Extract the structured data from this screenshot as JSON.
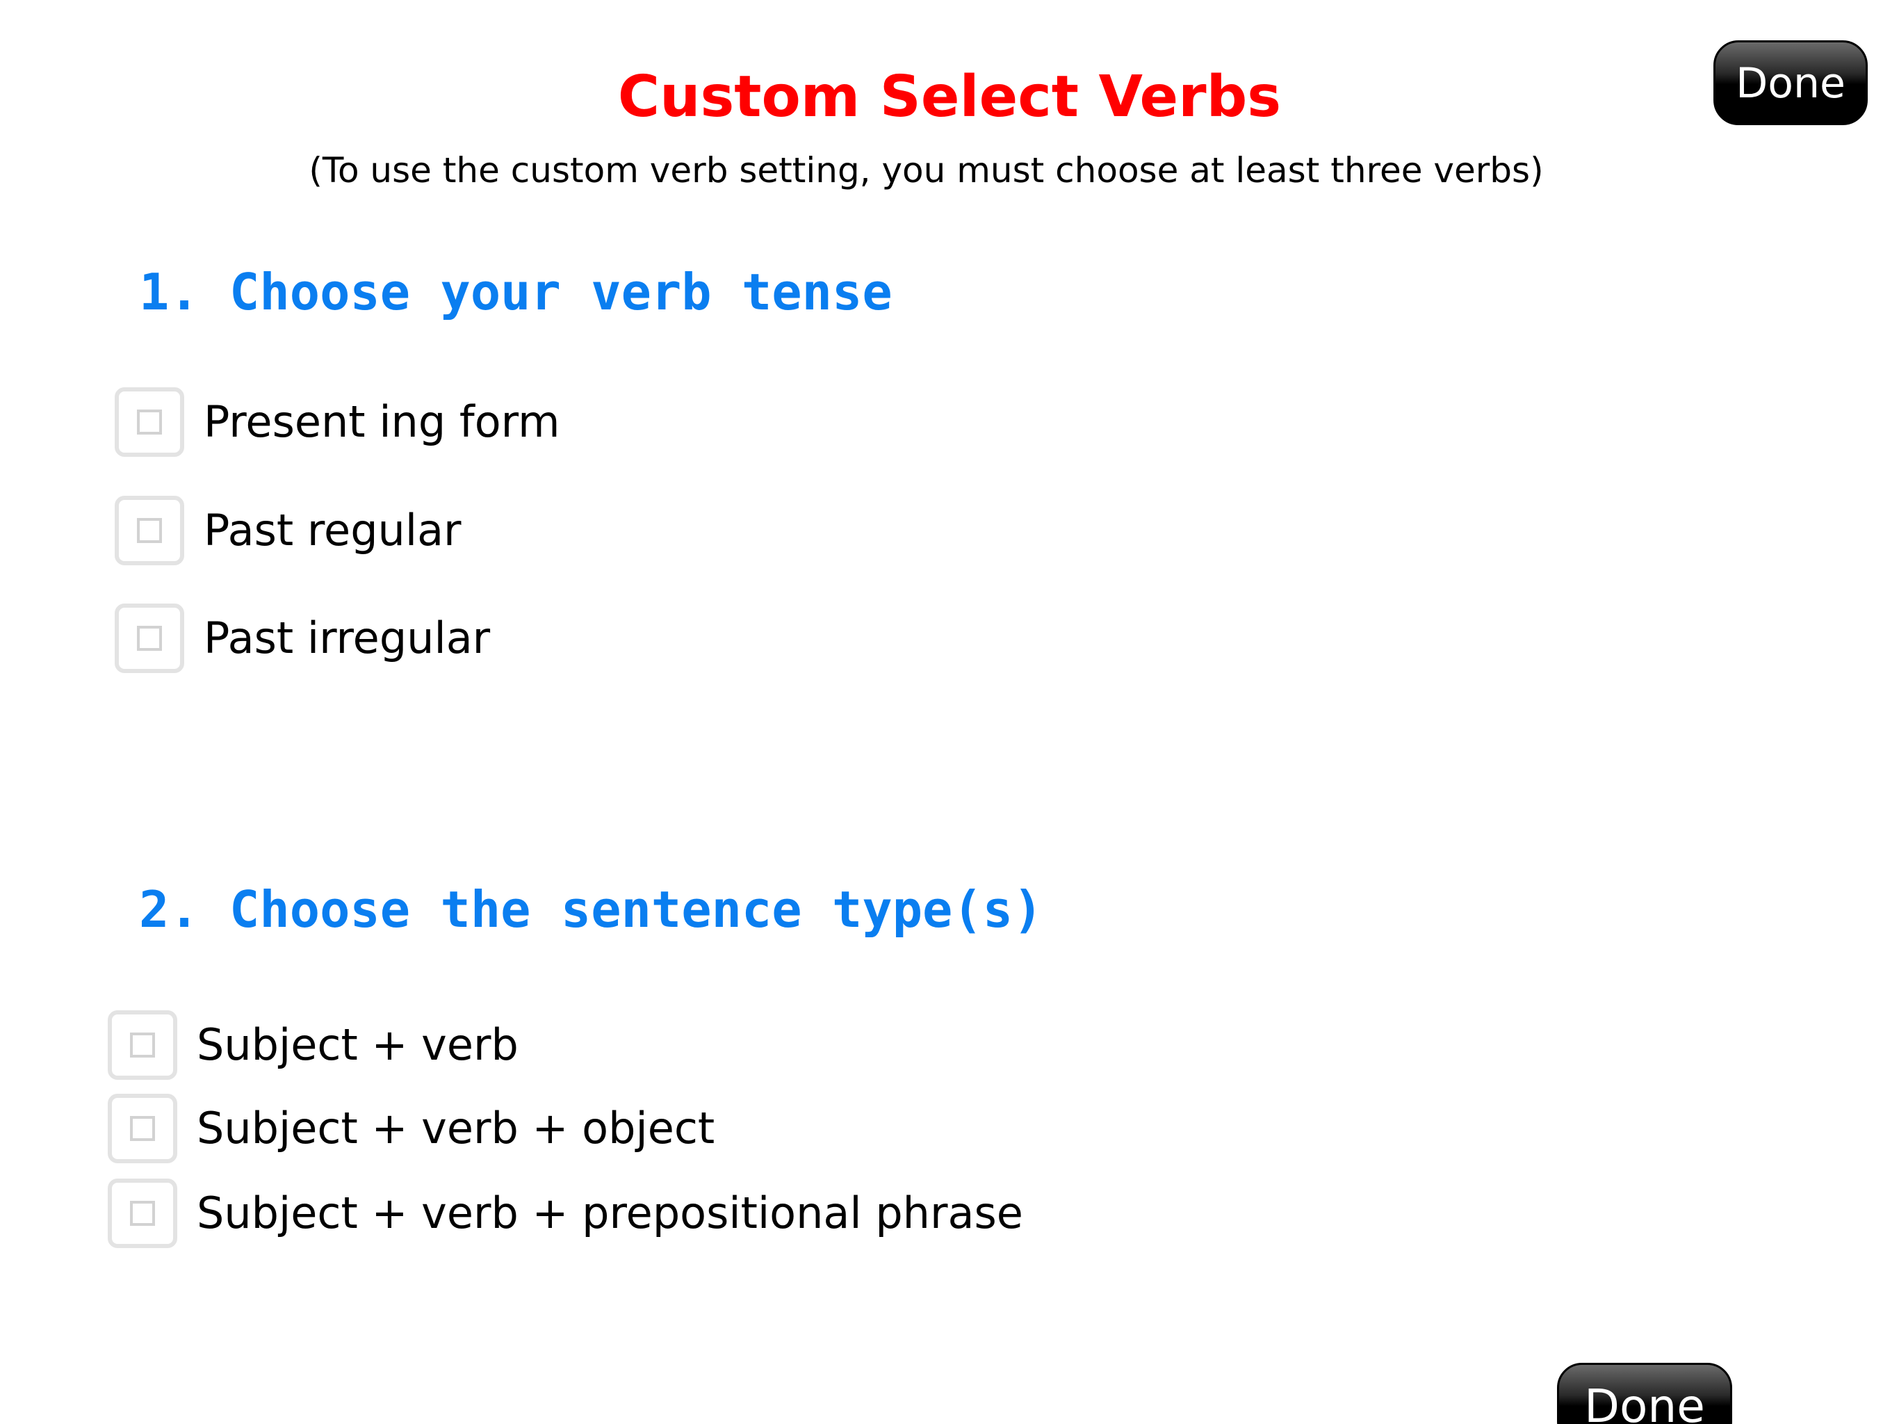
{
  "header": {
    "title": "Custom Select Verbs",
    "subtitle": "(To use the custom verb setting, you must choose at least three verbs)",
    "done_label": "Done"
  },
  "tense_section": {
    "heading": "1. Choose your verb tense",
    "options": [
      {
        "label": "Present ing form",
        "checked": false
      },
      {
        "label": "Past regular",
        "checked": false
      },
      {
        "label": "Past irregular",
        "checked": false
      }
    ]
  },
  "sentence_section": {
    "heading": "2. Choose the sentence type(s)",
    "options": [
      {
        "label": "Subject + verb",
        "checked": false
      },
      {
        "label": "Subject + verb + object",
        "checked": false
      },
      {
        "label": "Subject + verb + prepositional phrase",
        "checked": false
      }
    ]
  },
  "footer": {
    "done_label": "Done"
  },
  "colors": {
    "title": "#ff0000",
    "heading": "#0a7ef0",
    "button_bg": "#000000",
    "button_text": "#ffffff",
    "checkbox_border": "#e3e3e3"
  },
  "icons": {
    "checkbox": "empty-checkbox-icon"
  }
}
